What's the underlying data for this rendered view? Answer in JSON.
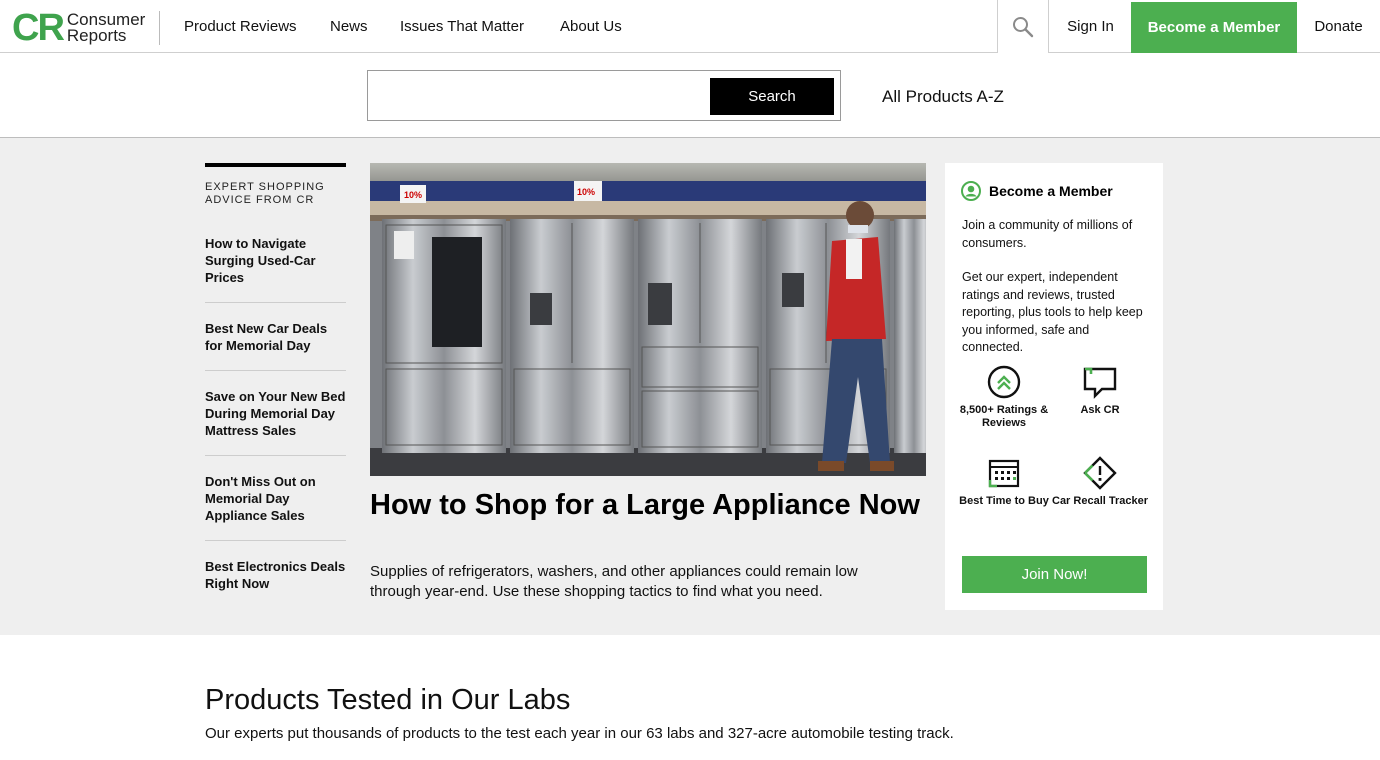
{
  "brand": {
    "logo_mark": "CR",
    "logo_line1": "Consumer",
    "logo_line2": "Reports",
    "accent_color": "#4caf50"
  },
  "nav": {
    "links": [
      "Product Reviews",
      "News",
      "Issues That Matter",
      "About Us"
    ],
    "search_icon": "search-icon",
    "sign_in": "Sign In",
    "become_member": "Become a Member",
    "donate": "Donate"
  },
  "search": {
    "value": "",
    "placeholder": "",
    "button": "Search",
    "all_products": "All Products A-Z"
  },
  "sidebar": {
    "kicker": "EXPERT SHOPPING ADVICE FROM CR",
    "items": [
      "How to Navigate Surging Used-Car Prices",
      "Best New Car Deals for Memorial Day",
      "Save on Your New Bed During Memorial Day Mattress Sales",
      "Don't Miss Out on Memorial Day Appliance Sales",
      "Best Electronics Deals Right Now"
    ]
  },
  "hero": {
    "image_icon": "appliance-store-photo",
    "sign_1": "10%",
    "sign_2": "10%",
    "title": "How to Shop for a Large Appliance Now",
    "description": "Supplies of refrigerators, washers, and other appliances could remain low through year-end. Use these shopping tactics to find what you need."
  },
  "member_card": {
    "title": "Become a Member",
    "icon": "member-icon",
    "p1": "Join a community of millions of consumers.",
    "p2": "Get our expert, independent ratings and reviews, trusted reporting, plus tools to help keep you informed, safe and connected.",
    "features": [
      {
        "label": "8,500+ Ratings & Reviews",
        "icon": "ratings-icon"
      },
      {
        "label": "Ask CR",
        "icon": "chat-icon"
      },
      {
        "label": "Best Time to Buy",
        "icon": "calendar-icon"
      },
      {
        "label": "Car Recall Tracker",
        "icon": "alert-diamond-icon"
      }
    ],
    "join_button": "Join Now!"
  },
  "labs": {
    "title": "Products Tested in Our Labs",
    "subtitle": "Our experts put thousands of products to the test each year in our 63 labs and 327-acre automobile testing track."
  }
}
